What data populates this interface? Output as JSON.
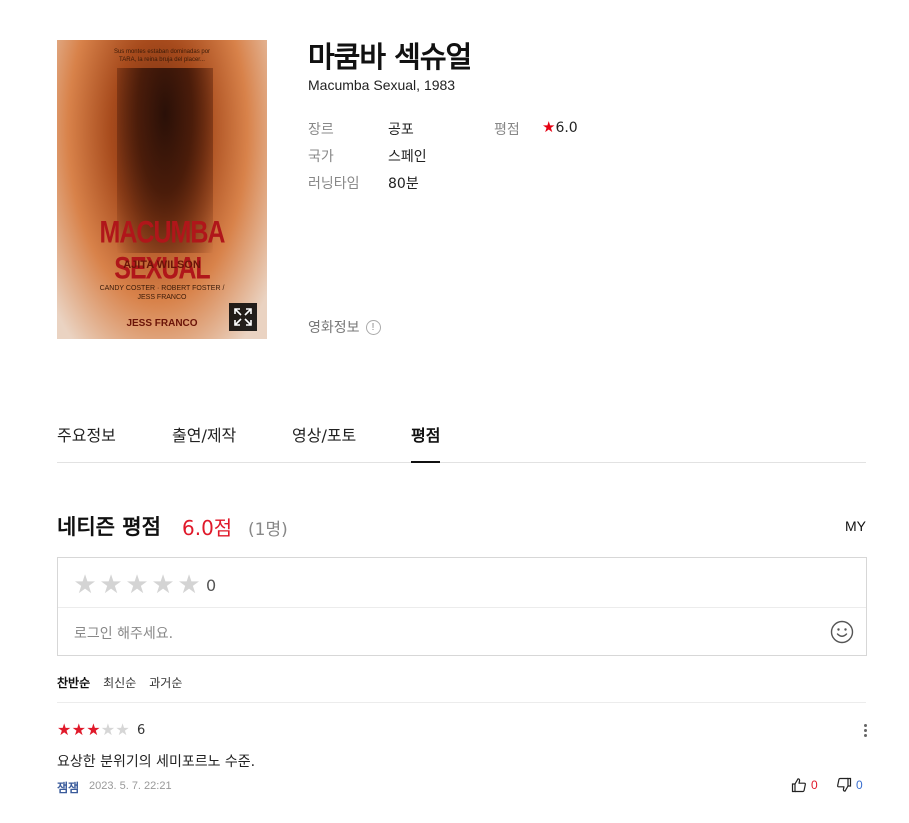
{
  "movie": {
    "title": "마쿰바 섹슈얼",
    "subtitle": "Macumba Sexual, 1983",
    "poster": {
      "tagline": "Sus montes estaban dominadas por TARA, la reina bruja del placer...",
      "title_text": "MACUMBA SEXUAL",
      "star_text": "AJITA WILSON",
      "cast_text": "CANDY COSTER · ROBERT FOSTER / JESS FRANCO",
      "director_text": "JESS FRANCO"
    },
    "info": {
      "genre_label": "장르",
      "genre_value": "공포",
      "country_label": "국가",
      "country_value": "스페인",
      "runtime_label": "러닝타임",
      "runtime_value": "80분",
      "rating_label": "평점",
      "rating_value": "6.0"
    },
    "movie_info_label": "영화정보",
    "info_icon_glyph": "!"
  },
  "tabs": [
    {
      "label": "주요정보",
      "active": false
    },
    {
      "label": "출연/제작",
      "active": false
    },
    {
      "label": "영상/포토",
      "active": false
    },
    {
      "label": "평점",
      "active": true
    }
  ],
  "rating_section": {
    "title": "네티즌 평점",
    "score": "6.0점",
    "count": "(1명)",
    "my_label": "MY",
    "input_score": "0",
    "login_placeholder": "로그인 해주세요."
  },
  "sort": [
    {
      "label": "찬반순",
      "active": true
    },
    {
      "label": "최신순",
      "active": false
    },
    {
      "label": "과거순",
      "active": false
    }
  ],
  "comments": [
    {
      "stars_filled": 3,
      "stars_total": 5,
      "score": "6",
      "text": "요상한 분위기의 세미포르노 수준.",
      "author": "잼잼",
      "date": "2023. 5. 7. 22:21",
      "likes": "0",
      "dislikes": "0"
    }
  ],
  "colors": {
    "accent_red": "#e0192a",
    "author_blue": "#3a5b9b",
    "dislike_blue": "#3a6fd0"
  },
  "icons": [
    "expand-icon",
    "star-icon",
    "info-icon",
    "smiley-icon",
    "more-icon",
    "thumbs-up-icon",
    "thumbs-down-icon"
  ]
}
